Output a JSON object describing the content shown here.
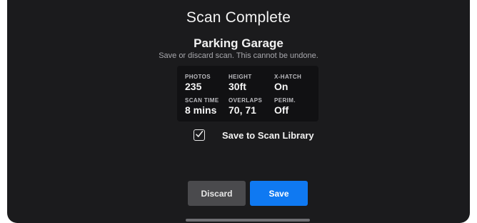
{
  "dialog": {
    "title": "Scan Complete",
    "scan_name": "Parking Garage",
    "description": "Save or discard scan. This cannot be undone."
  },
  "stats": {
    "photos": {
      "label": "PHOTOS",
      "value": "235"
    },
    "height": {
      "label": "HEIGHT",
      "value": "30ft"
    },
    "crosshatch": {
      "label": "X-HATCH",
      "value": "On"
    },
    "scan_time": {
      "label": "SCAN TIME",
      "value": "8 mins"
    },
    "overlaps": {
      "label": "OVERLAPS",
      "value": "70, 71"
    },
    "perimeter": {
      "label": "PERIM.",
      "value": "Off"
    }
  },
  "library_option": {
    "label": "Save to Scan Library",
    "checked": true,
    "icon": "checkbox-checked-icon"
  },
  "buttons": {
    "discard": "Discard",
    "save": "Save"
  },
  "colors": {
    "background": "#1b1b1d",
    "card": "#111113",
    "primary": "#0f79f2",
    "secondary": "#4a4a4d"
  }
}
